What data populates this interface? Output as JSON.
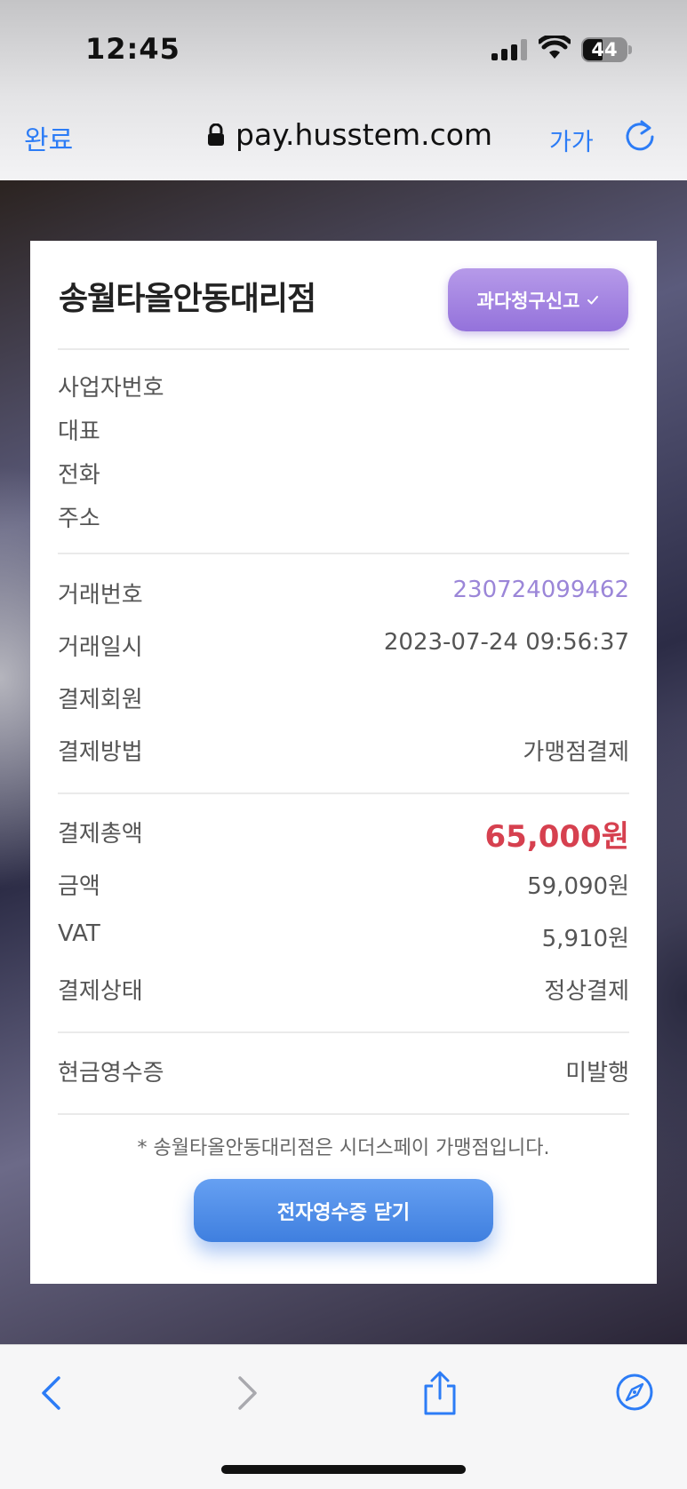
{
  "status_bar": {
    "time": "12:45",
    "battery": "44"
  },
  "browser": {
    "done_label": "완료",
    "url": "pay.husstem.com",
    "text_size_label": "가가"
  },
  "receipt": {
    "merchant_name": "송월타올안동대리점",
    "report_button": "과다청구신고",
    "business_info": [
      {
        "label": "사업자번호",
        "value": ""
      },
      {
        "label": "대표",
        "value": ""
      },
      {
        "label": "전화",
        "value": ""
      },
      {
        "label": "주소",
        "value": ""
      }
    ],
    "transaction": [
      {
        "label": "거래번호",
        "value": "230724099462"
      },
      {
        "label": "거래일시",
        "value": "2023-07-24 09:56:37"
      },
      {
        "label": "결제회원",
        "value": ""
      },
      {
        "label": "결제방법",
        "value": "가맹점결제"
      }
    ],
    "amounts": [
      {
        "label": "결제총액",
        "value": "65,000원"
      },
      {
        "label": "금액",
        "value": "59,090원"
      },
      {
        "label": "VAT",
        "value": "5,910원"
      },
      {
        "label": "결제상태",
        "value": "정상결제"
      }
    ],
    "cash_receipt": {
      "label": "현금영수증",
      "value": "미발행"
    },
    "notice": "* 송월타올안동대리점은 시더스페이 가맹점입니다.",
    "close_button": "전자영수증 닫기"
  },
  "colors": {
    "accent": "#2c7cf6",
    "purple": "#9b86d8",
    "total_red": "#d6404f"
  }
}
